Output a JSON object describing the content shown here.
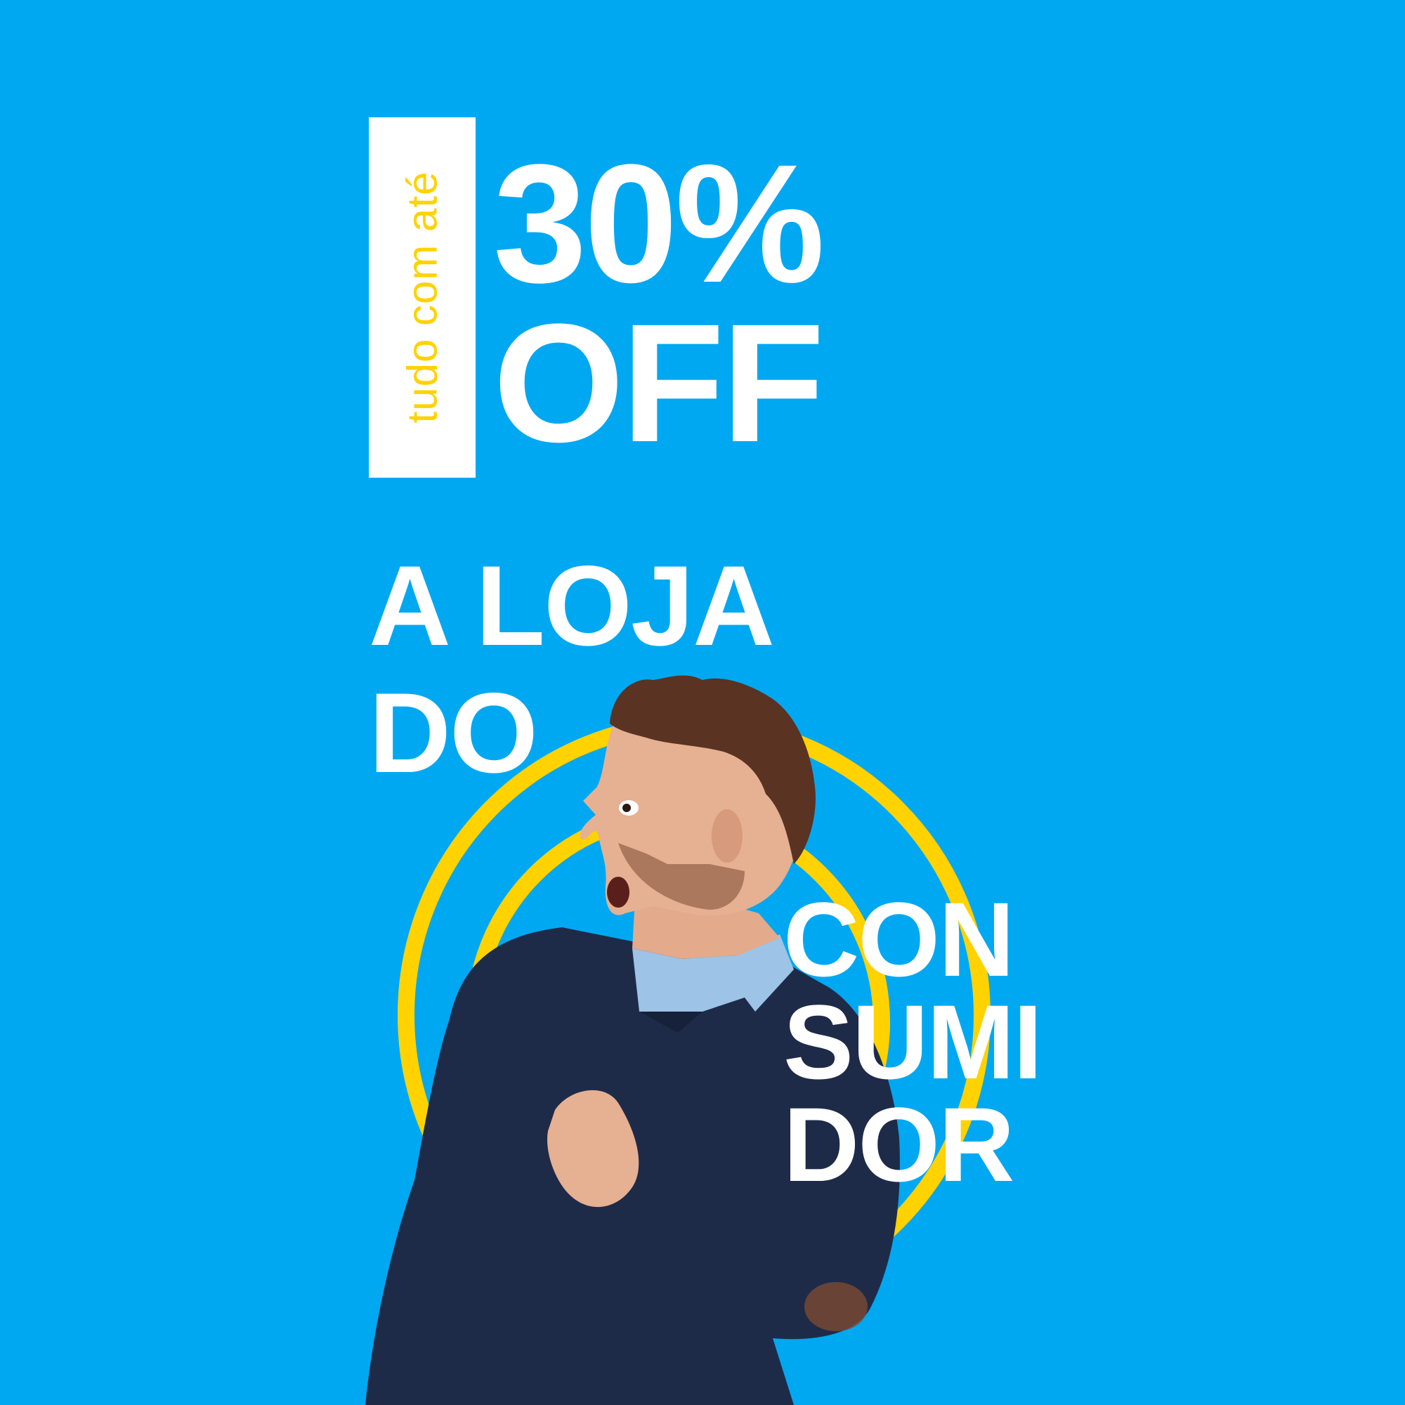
{
  "colors": {
    "background": "#00A8F2",
    "accent_yellow": "#FFD200",
    "text_white": "#FFFFFF",
    "sweater_navy": "#1E2B48",
    "shirt_blue": "#9DC3E6"
  },
  "tag": {
    "text": "tudo com até"
  },
  "headline": {
    "discount": "30%",
    "off": "OFF",
    "line1": "A LOJA",
    "line2": "DO",
    "word_part1": "CON",
    "word_part2": "SUMI",
    "word_part3": "DOR"
  }
}
